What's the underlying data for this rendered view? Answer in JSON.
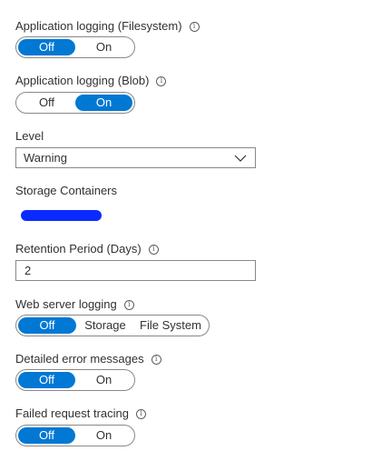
{
  "app_logging_fs": {
    "label": "Application logging (Filesystem)",
    "options": [
      "Off",
      "On"
    ],
    "selected": "Off"
  },
  "app_logging_blob": {
    "label": "Application logging (Blob)",
    "options": [
      "Off",
      "On"
    ],
    "selected": "On"
  },
  "level": {
    "label": "Level",
    "value": "Warning"
  },
  "storage_containers": {
    "label": "Storage Containers"
  },
  "retention": {
    "label": "Retention Period (Days)",
    "value": "2"
  },
  "web_server_logging": {
    "label": "Web server logging",
    "options": [
      "Off",
      "Storage",
      "File System"
    ],
    "selected": "Off"
  },
  "detailed_errors": {
    "label": "Detailed error messages",
    "options": [
      "Off",
      "On"
    ],
    "selected": "Off"
  },
  "failed_request_tracing": {
    "label": "Failed request tracing",
    "options": [
      "Off",
      "On"
    ],
    "selected": "Off"
  },
  "info_glyph": "i",
  "colors": {
    "accent": "#0078d4",
    "redaction": "#0a2bff",
    "border": "#8a8886",
    "text": "#323130"
  },
  "icons": {
    "info": "info-icon",
    "dropdown": "chevron-down-icon"
  }
}
